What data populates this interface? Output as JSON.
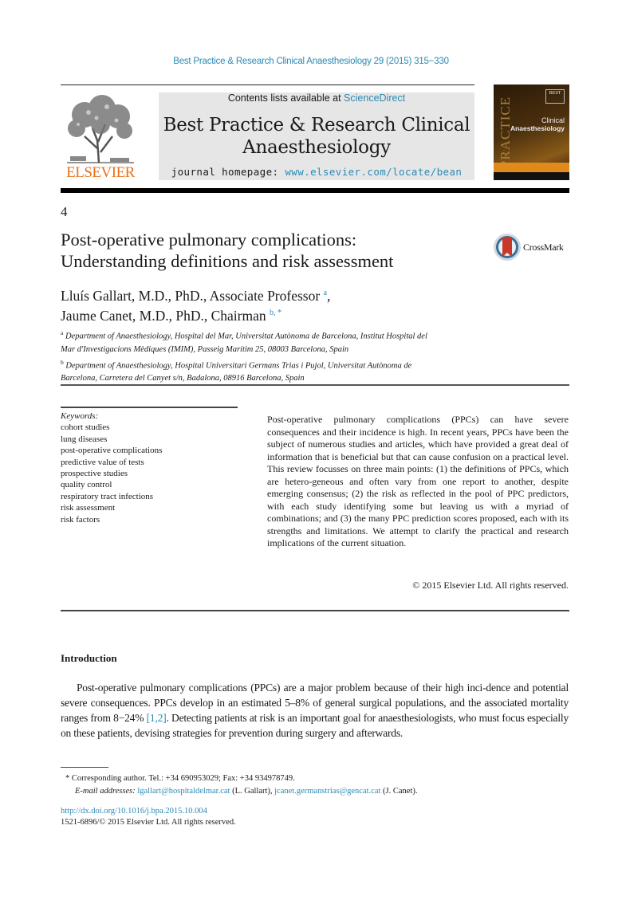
{
  "header": {
    "journal_citation": "Best Practice & Research Clinical Anaesthesiology 29 (2015) 315−330",
    "contents_prefix": "Contents lists available at ",
    "contents_link": "ScienceDirect",
    "journal_title_line1": "Best Practice & Research Clinical",
    "journal_title_line2": "Anaesthesiology",
    "homepage_prefix": "journal homepage: ",
    "homepage_link": "www.elsevier.com/locate/bean",
    "publisher_logo_text": "ELSEVIER",
    "cover": {
      "badge": "BEST",
      "side_text": "PRACTICE",
      "title_light": "Clinical",
      "title_bold": "Anaesthesiology"
    },
    "colors": {
      "link": "#2a8ab5",
      "elsevier_orange": "#e8711c",
      "header_box": "#e6e6e6"
    }
  },
  "article": {
    "chapter_number": "4",
    "title_line1": "Post-operative pulmonary complications:",
    "title_line2": "Understanding definitions and risk assessment",
    "crossmark_label": "CrossMark",
    "authors": [
      {
        "name": "Lluís Gallart, M.D., PhD., Associate Professor",
        "sup": "a",
        "trail": ","
      },
      {
        "name": "Jaume Canet, M.D., PhD., Chairman",
        "sup": "b, *",
        "trail": ""
      }
    ],
    "affiliations": [
      {
        "mark": "a",
        "line1": "Department of Anaesthesiology, Hospital del Mar, Universitat Autònoma de Barcelona, Institut Hospital del",
        "line2": "Mar d'Investigacions Mèdiques (IMIM), Passeig Marítim 25, 08003 Barcelona, Spain"
      },
      {
        "mark": "b",
        "line1": "Department of Anaesthesiology, Hospital Universitari Germans Trias i Pujol, Universitat Autònoma de",
        "line2": "Barcelona, Carretera del Canyet s/n, Badalona, 08916 Barcelona, Spain"
      }
    ]
  },
  "keywords": {
    "label": "Keywords:",
    "items": [
      "cohort studies",
      "lung diseases",
      "post-operative complications",
      "predictive value of tests",
      "prospective studies",
      "quality control",
      "respiratory tract infections",
      "risk assessment",
      "risk factors"
    ]
  },
  "abstract": {
    "text": "Post-operative pulmonary complications (PPCs) can have severe consequences and their incidence is high. In recent years, PPCs have been the subject of numerous studies and articles, which have provided a great deal of information that is beneficial but that can cause confusion on a practical level. This review focusses on three main points: (1) the definitions of PPCs, which are hetero-geneous and often vary from one report to another, despite emerging consensus; (2) the risk as reflected in the pool of PPC predictors, with each study identifying some but leaving us with a myriad of combinations; and (3) the many PPC prediction scores proposed, each with its strengths and limitations. We attempt to clarify the practical and research implications of the current situation.",
    "copyright": "© 2015 Elsevier Ltd. All rights reserved."
  },
  "body": {
    "intro_heading": "Introduction",
    "intro_text_before_ref": "Post-operative pulmonary complications (PPCs) are a major problem because of their high inci-dence and potential severe consequences. PPCs develop in an estimated 5–8% of general surgical populations, and the associated mortality ranges from 8−24% ",
    "intro_ref": "[1,2]",
    "intro_text_after_ref": ". Detecting patients at risk is an important goal for anaesthesiologists, who must focus especially on these patients, devising strategies for prevention during surgery and afterwards."
  },
  "footnotes": {
    "corresponding": "* Corresponding author. Tel.: +34 690953029; Fax: +34 934978749.",
    "email_label": "E-mail addresses:",
    "email1": "lgallart@hospitaldelmar.cat",
    "email1_name": " (L. Gallart), ",
    "email2": "jcanet.germanstrias@gencat.cat",
    "email2_name": " (J. Canet).",
    "doi": "http://dx.doi.org/10.1016/j.bpa.2015.10.004",
    "issn": "1521-6896/© 2015 Elsevier Ltd. All rights reserved."
  }
}
